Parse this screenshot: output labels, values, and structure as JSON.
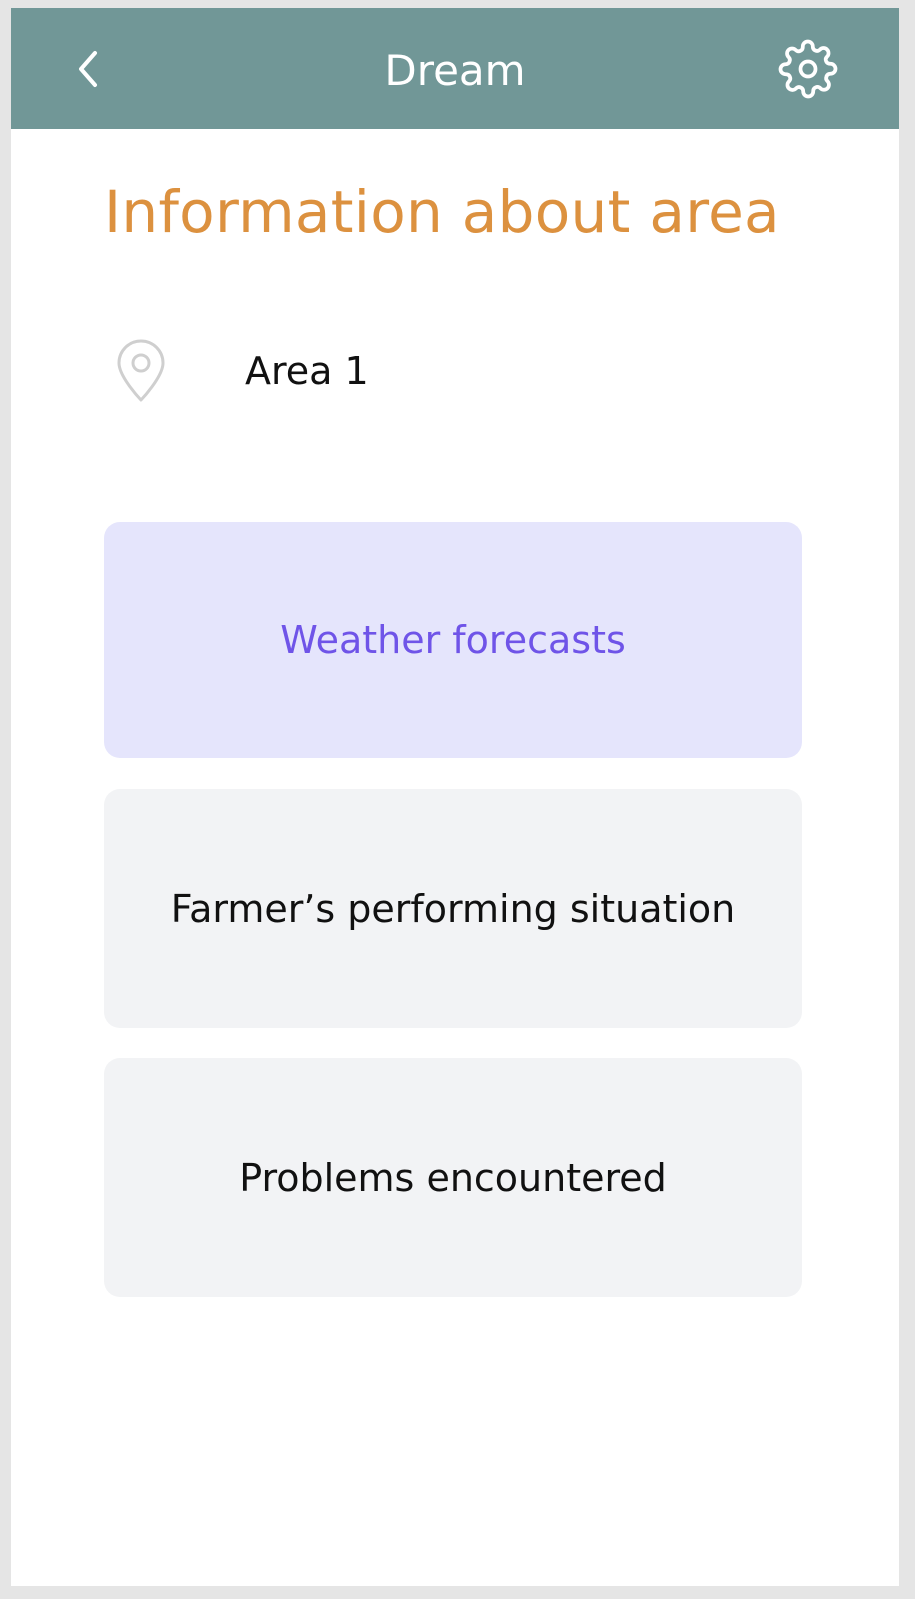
{
  "header": {
    "title": "Dream",
    "back_icon": "chevron-left-icon",
    "settings_icon": "gear-icon",
    "background_color": "#719797"
  },
  "main": {
    "title": "Information about area",
    "title_color": "#dc913f",
    "location": {
      "icon": "map-pin-icon",
      "name": "Area 1"
    },
    "cards": [
      {
        "label": "Weather forecasts",
        "selected": true
      },
      {
        "label": "Farmer’s performing situation",
        "selected": false
      },
      {
        "label": "Problems encountered",
        "selected": false
      }
    ],
    "colors": {
      "selected_card_bg": "#e5e5fc",
      "selected_card_text": "#6f54e8",
      "card_bg": "#f2f3f5"
    }
  }
}
